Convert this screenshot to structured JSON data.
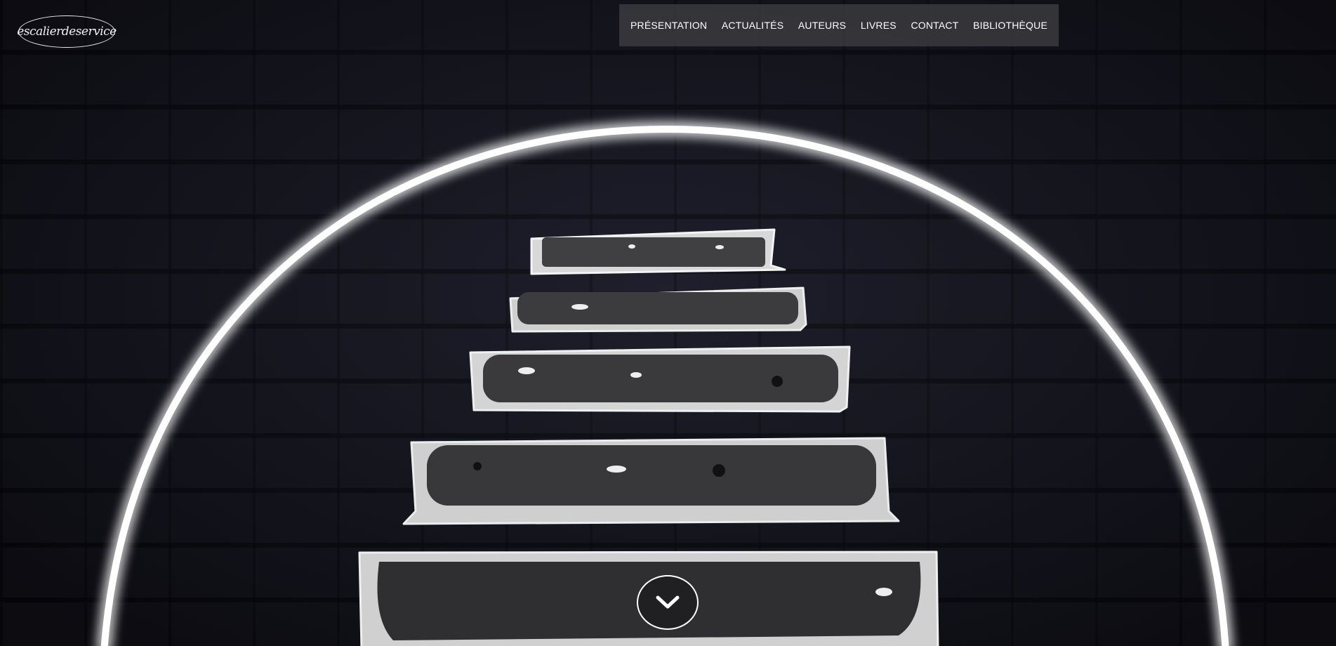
{
  "header": {
    "logo_text": "escalierdeservice"
  },
  "nav": {
    "items": [
      {
        "label": "PRÉSENTATION"
      },
      {
        "label": "ACTUALITÉS"
      },
      {
        "label": "AUTEURS"
      },
      {
        "label": "LIVRES"
      },
      {
        "label": "CONTACT"
      },
      {
        "label": "BIBLIOTHÈQUE"
      }
    ]
  },
  "hero": {
    "scroll_icon": "chevron-down-icon"
  },
  "colors": {
    "nav_background": "#3c3c40",
    "wall": "#1a1a26",
    "glow": "#ffffff",
    "stair_fill": "#3a3a3c",
    "stair_edge": "#dcdcdc"
  }
}
